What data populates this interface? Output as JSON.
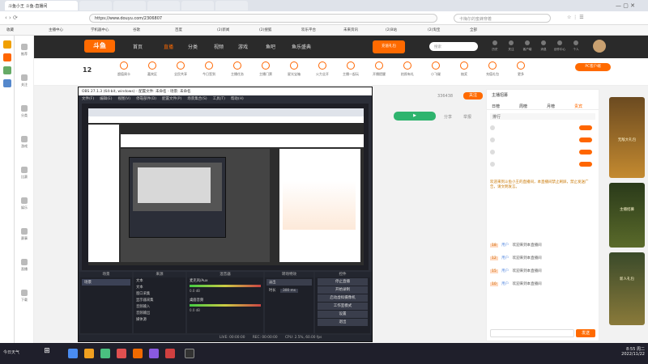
{
  "browser": {
    "tabs": [
      {
        "label": "斗鱼小王 斗鱼-直播间"
      },
      {
        "label": ""
      },
      {
        "label": ""
      },
      {
        "label": ""
      },
      {
        "label": ""
      },
      {
        "label": ""
      },
      {
        "label": ""
      },
      {
        "label": ""
      },
      {
        "label": ""
      },
      {
        "label": ""
      }
    ],
    "url": "https://www.douyu.com/2306807",
    "search_placeholder": "卡梅尔的蜜蜂穿着",
    "bookmarks": [
      "收藏",
      "主播中心",
      "学机器中心",
      "谷歌",
      "百度",
      "(2)新闻",
      "(2)搜狐",
      "欢乐平台",
      "未来资讯",
      "(2)B站",
      "(2)淘宝",
      "全部"
    ]
  },
  "site": {
    "logo": "斗鱼",
    "nav": [
      "首页",
      "直播",
      "分类",
      "视频",
      "游戏",
      "鱼吧",
      "鱼乐盛典"
    ],
    "nav_promo": "充值礼包",
    "search_hint": "搜索",
    "user_links": [
      "历史",
      "关注",
      "客户端",
      "消息",
      "创作中心",
      "个人"
    ],
    "subnav": [
      "超值周卡",
      "嘉宾区",
      "全民共享",
      "今日签到",
      "主播任务",
      "主播门票",
      "星光宝箱",
      "火力全开",
      "主播一起玩",
      "开播提醒",
      "拍照有礼",
      "小飞碟",
      "抽奖",
      "充值礼包",
      "更多"
    ],
    "follower_count": "12",
    "pc_client_btn": "PC客户端",
    "follow_btn": "关注",
    "room_id": "336438",
    "report_links": [
      "分享",
      "举报"
    ],
    "left_sidebar": [
      "推荐",
      "关注",
      "分类",
      "游戏",
      "比赛",
      "娱乐",
      "赛事",
      "直播",
      "下载"
    ]
  },
  "chat": {
    "header_title": "主播招募",
    "rank_tabs": [
      "日榜",
      "周榜",
      "月榜",
      "贵宾"
    ],
    "rank_title": "排行",
    "rank_items": [
      {
        "name": "",
        "btn": ""
      },
      {
        "name": "",
        "btn": ""
      },
      {
        "name": "",
        "btn": ""
      },
      {
        "name": "",
        "btn": ""
      }
    ],
    "announcement": "欢迎来到斗鱼小王的直播间，本直播间禁止刷屏，禁止发送广告，请文明发言。",
    "messages": [
      {
        "level": "18",
        "user": "用户",
        "text": "欢迎来到本直播间"
      },
      {
        "level": "12",
        "user": "用户",
        "text": "欢迎来到本直播间"
      },
      {
        "level": "15",
        "user": "用户",
        "text": "欢迎来到本直播间"
      },
      {
        "level": "10",
        "user": "用户",
        "text": "欢迎来到本直播间"
      }
    ],
    "input_placeholder": "",
    "send_btn": "发送"
  },
  "right_ads": [
    {
      "title": "无敌大礼包"
    },
    {
      "title": "主播招募"
    },
    {
      "title": "新人礼包"
    }
  ],
  "obs": {
    "title": "OBS 27.1.3 (64-bit, windows) - 配置文件: 未命名 - 场景: 未命名",
    "menu": [
      "文件(F)",
      "编辑(E)",
      "视图(V)",
      "停靠部件(D)",
      "配置文件(P)",
      "场景集合(S)",
      "工具(T)",
      "帮助(H)"
    ],
    "panels": [
      "场景",
      "来源",
      "混音器",
      "转场特效",
      "控件"
    ],
    "scene": "场景",
    "sources": [
      "文本",
      "文本",
      "窗口采集",
      "显示器采集",
      "音频输入",
      "音频输出",
      "媒体源"
    ],
    "mixer": [
      {
        "name": "麦克风/Aux",
        "db": "0.0 dB"
      },
      {
        "name": "桌面音频",
        "db": "0.0 dB"
      }
    ],
    "transition": "淡出",
    "duration_label": "时长",
    "duration": "300 ms",
    "controls": [
      "停止直播",
      "开始录制",
      "启动虚拟摄像机",
      "工作室模式",
      "设置",
      "退出"
    ],
    "status": {
      "live": "LIVE: 00:00:00",
      "rec": "REC: 00:00:00",
      "cpu": "CPU: 2.5%, 60.00 fps"
    }
  },
  "taskbar": {
    "weather": "今日天气",
    "clock": "8:55 周二",
    "date": "2022/11/22"
  },
  "colors": {
    "brand": "#ff6a00",
    "nav_bg": "#2a2a2a",
    "obs_bg": "#2b2e38",
    "taskbar_bg": "#1f1f2b"
  }
}
